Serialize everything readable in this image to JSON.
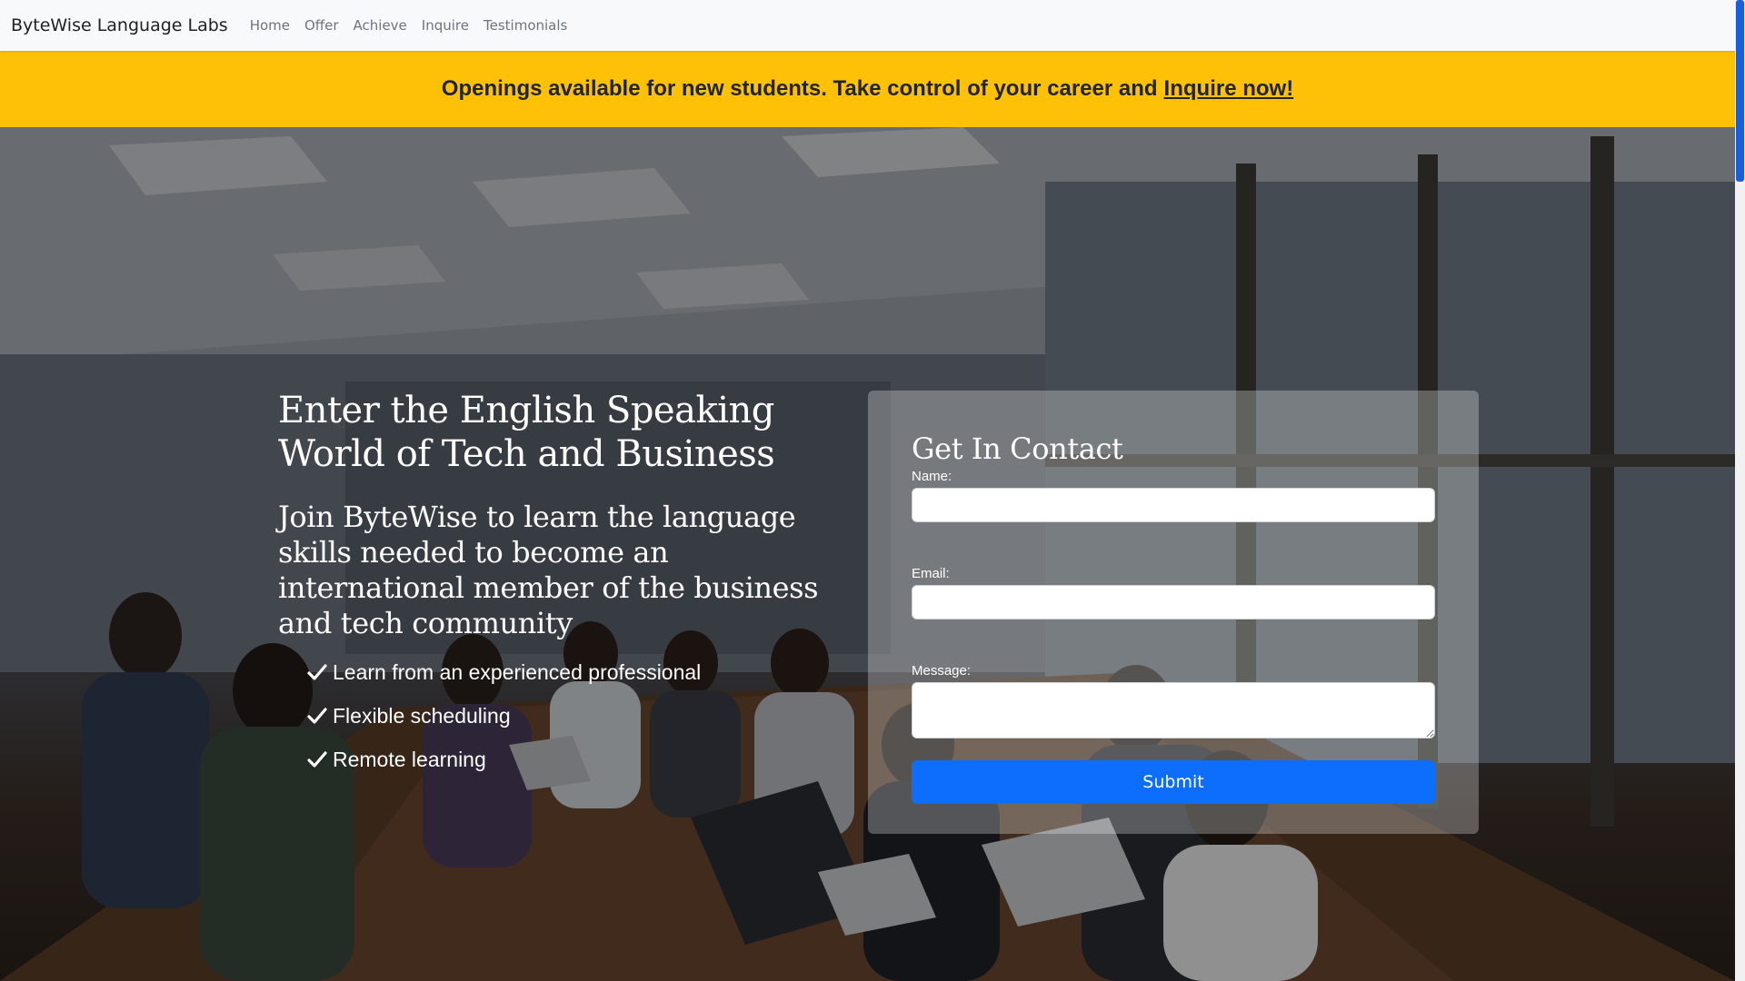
{
  "navbar": {
    "brand": "ByteWise Language Labs",
    "links": [
      "Home",
      "Offer",
      "Achieve",
      "Inquire",
      "Testimonials"
    ]
  },
  "banner": {
    "text": "Openings available for new students. Take control of your career and",
    "link_text": "Inquire now!",
    "color": "#ffc107"
  },
  "hero": {
    "title": "Enter the English Speaking World of Tech and Business",
    "subtitle": "Join ByteWise to learn the language skills needed to become an international member of the business and tech community",
    "features": [
      "Learn from an experienced professional",
      "Flexible scheduling",
      "Remote learning"
    ],
    "feature_icon": "check-icon",
    "background_image": "conference-room-meeting-photo"
  },
  "contact_form": {
    "title": "Get In Contact",
    "name_label": "Name:",
    "name_value": "",
    "email_label": "Email:",
    "email_value": "",
    "message_label": "Message:",
    "message_value": "",
    "submit_label": "Submit",
    "submit_color": "#0d6efd"
  }
}
